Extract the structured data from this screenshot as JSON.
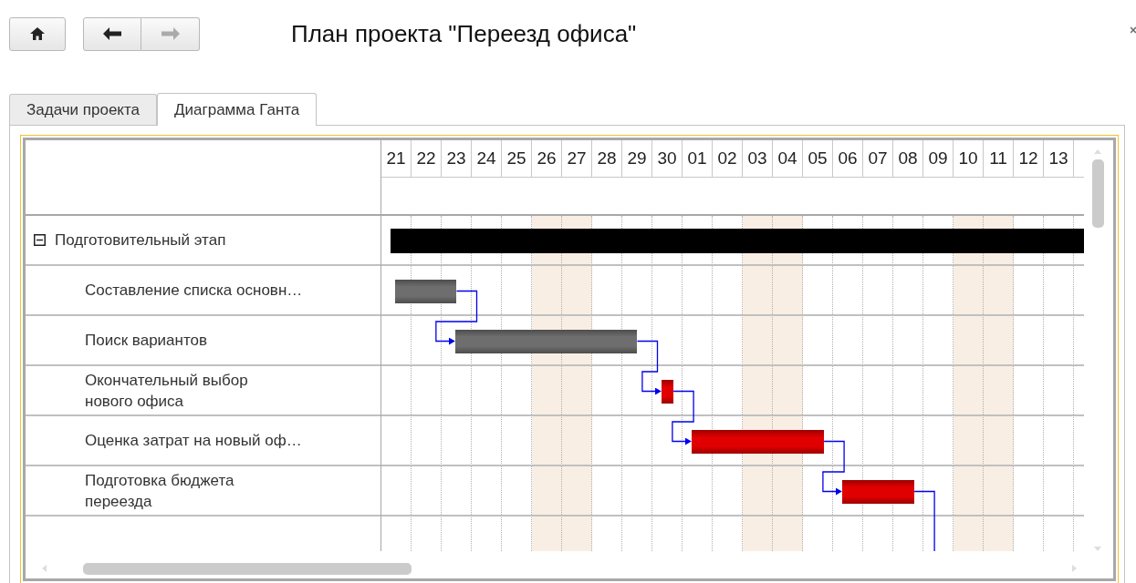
{
  "title": "План проекта \"Переезд офиса\"",
  "tabs": [
    {
      "label": "Задачи проекта",
      "selected": false
    },
    {
      "label": "Диаграмма Ганта",
      "selected": true
    }
  ],
  "gantt": {
    "tasks": [
      {
        "kind": "group",
        "name": "Подготовительный этап",
        "expanded": true,
        "color": "#000000",
        "children": [
          {
            "kind": "task",
            "name": "Составление списка основн…",
            "color": "#6e6e6e",
            "link_to_next": true
          },
          {
            "kind": "task",
            "name": "Поиск вариантов",
            "color": "#6e6e6e",
            "link_to_next": true
          },
          {
            "kind": "task",
            "name": "Окончательный выбор\nнового офиса",
            "color": "#e00000",
            "link_to_next": true
          },
          {
            "kind": "task",
            "name": "Оценка затрат на новый оф…",
            "color": "#e00000",
            "link_to_next": true
          },
          {
            "kind": "task",
            "name": "Подготовка бюджета\nпереезда",
            "color": "#e00000",
            "link_to_next": true
          }
        ]
      }
    ],
    "days": [
      {
        "label": "21",
        "weekend": false
      },
      {
        "label": "22",
        "weekend": false
      },
      {
        "label": "23",
        "weekend": false
      },
      {
        "label": "24",
        "weekend": false
      },
      {
        "label": "25",
        "weekend": false
      },
      {
        "label": "26",
        "weekend": true
      },
      {
        "label": "27",
        "weekend": true
      },
      {
        "label": "28",
        "weekend": false
      },
      {
        "label": "29",
        "weekend": false
      },
      {
        "label": "30",
        "weekend": false
      },
      {
        "label": "01",
        "weekend": false
      },
      {
        "label": "02",
        "weekend": false
      },
      {
        "label": "03",
        "weekend": true
      },
      {
        "label": "04",
        "weekend": true
      },
      {
        "label": "05",
        "weekend": false
      },
      {
        "label": "06",
        "weekend": false
      },
      {
        "label": "07",
        "weekend": false
      },
      {
        "label": "08",
        "weekend": false
      },
      {
        "label": "09",
        "weekend": false
      },
      {
        "label": "10",
        "weekend": true
      },
      {
        "label": "11",
        "weekend": true
      },
      {
        "label": "12",
        "weekend": false
      },
      {
        "label": "13",
        "weekend": false
      }
    ]
  }
}
